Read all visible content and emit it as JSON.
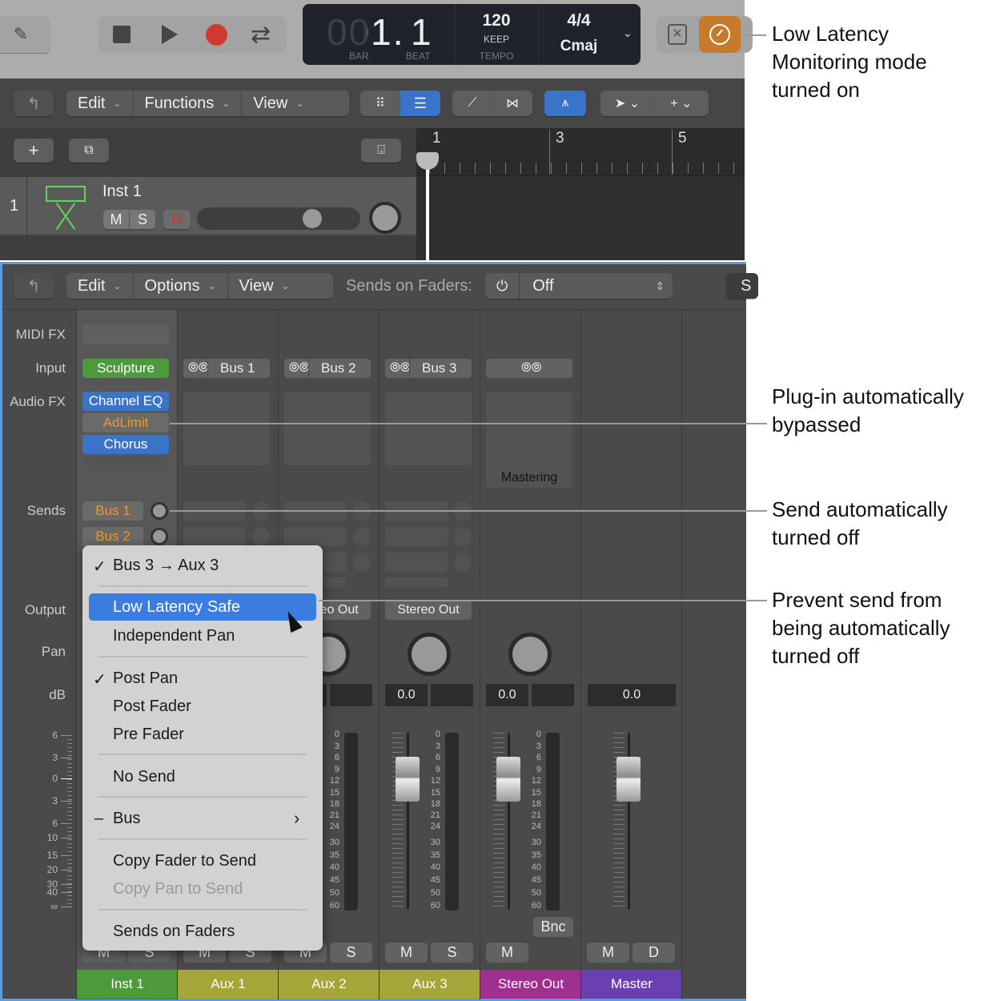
{
  "control_bar": {
    "bar": "001.",
    "bar_dim": "00",
    "bar_bright": "1.",
    "beat": "1",
    "bar_label": "BAR",
    "beat_label": "BEAT",
    "tempo": "120",
    "tempo_mode": "KEEP",
    "tempo_label": "TEMPO",
    "signature": "4/4",
    "key": "Cmaj",
    "accent_orange": "#c87a2c",
    "record_color": "#d0392e"
  },
  "tracks_toolbar": {
    "edit": "Edit",
    "functions": "Functions",
    "view": "View"
  },
  "ruler": {
    "marks": [
      "1",
      "3",
      "5"
    ]
  },
  "track": {
    "number": "1",
    "name": "Inst 1",
    "mute": "M",
    "solo": "S",
    "record": "R"
  },
  "mixer_toolbar": {
    "edit": "Edit",
    "options": "Options",
    "view": "View",
    "sends_on_faders_label": "Sends on Faders:",
    "sends_on_faders_value": "Off",
    "partial": "S"
  },
  "row_labels": {
    "midi_fx": "MIDI FX",
    "input": "Input",
    "audio_fx": "Audio FX",
    "sends": "Sends",
    "output": "Output",
    "pan": "Pan",
    "db": "dB"
  },
  "db_scale": [
    "6",
    "3",
    "0",
    "3",
    "6",
    "10",
    "15",
    "20",
    "30",
    "40",
    "∞"
  ],
  "meter_scale": [
    "0",
    "3",
    "6",
    "9",
    "12",
    "15",
    "18",
    "21",
    "24",
    "30",
    "35",
    "40",
    "45",
    "50",
    "60"
  ],
  "channels": [
    {
      "name": "Inst 1",
      "color": "#4c9a3c",
      "input": "Sculpture",
      "audio_fx": [
        {
          "name": "Channel EQ",
          "state": "active"
        },
        {
          "name": "AdLimit",
          "state": "bypassed"
        },
        {
          "name": "Chorus",
          "state": "active"
        }
      ],
      "sends": [
        "Bus 1",
        "Bus 2"
      ],
      "buttons": [
        "M",
        "S"
      ]
    },
    {
      "name": "Aux 1",
      "color": "#a5a539",
      "input": "Bus 1",
      "buttons": [
        "M",
        "S"
      ]
    },
    {
      "name": "Aux 2",
      "color": "#a5a539",
      "input": "Bus 2",
      "output": "Stereo Out",
      "buttons": [
        "M",
        "S"
      ]
    },
    {
      "name": "Aux 3",
      "color": "#a5a539",
      "input": "Bus 3",
      "output": "Stereo Out",
      "db": "0.0",
      "buttons": [
        "M",
        "S"
      ]
    },
    {
      "name": "Stereo Out",
      "color": "#a0308f",
      "input": "",
      "fx_label": "Mastering",
      "db": "0.0",
      "bounce": "Bnc",
      "buttons": [
        "M"
      ]
    },
    {
      "name": "Master",
      "color": "#6a40b0",
      "db": "0.0",
      "buttons": [
        "M",
        "D"
      ]
    }
  ],
  "context_menu": {
    "items": [
      "Bus 3 → Aux 3",
      "Low Latency Safe",
      "Independent Pan",
      "Post Pan",
      "Post Fader",
      "Pre Fader",
      "No Send",
      "Bus",
      "Copy Fader to Send",
      "Copy Pan to Send",
      "Sends on Faders"
    ],
    "check": "✓",
    "dash": "–"
  },
  "annotations": [
    "Low Latency Monitoring mode turned on",
    "Plug-in automatically bypassed",
    "Send automatically turned off",
    "Prevent send from being automatically turned off"
  ]
}
